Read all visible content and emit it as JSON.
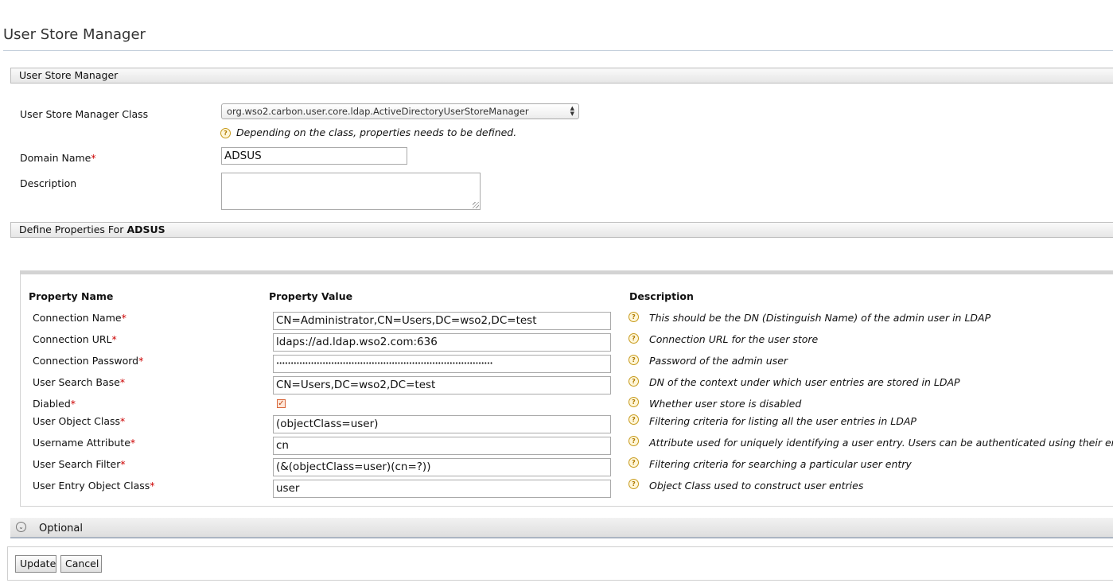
{
  "page_title": "User Store Manager",
  "section_general": {
    "title": "User Store Manager"
  },
  "form": {
    "class_label": "User Store Manager Class",
    "class_value": "org.wso2.carbon.user.core.ldap.ActiveDirectoryUserStoreManager",
    "class_hint": "Depending on the class, properties needs to be defined.",
    "domain_label": "Domain Name",
    "domain_value": "ADSUS",
    "description_label": "Description",
    "description_value": "",
    "required_marker": "*"
  },
  "section_properties": {
    "prefix": "Define Properties For ",
    "domain": "ADSUS"
  },
  "properties_table": {
    "headers": {
      "name": "Property Name",
      "value": "Property Value",
      "description": "Description"
    },
    "rows": [
      {
        "name": "Connection Name",
        "value": "CN=Administrator,CN=Users,DC=wso2,DC=test",
        "description": "This should be the DN (Distinguish Name) of the admin user in LDAP"
      },
      {
        "name": "Connection URL",
        "value": "ldaps://ad.ldap.wso2.com:636",
        "description": "Connection URL for the user store"
      },
      {
        "name": "Connection Password",
        "value": "•••••••••••••••••••••••••••••••••••••••••••••••••••••••••••••••••••••••••••",
        "description": "Password of the admin user"
      },
      {
        "name": "User Search Base",
        "value": "CN=Users,DC=wso2,DC=test",
        "description": "DN of the context under which user entries are stored in LDAP"
      },
      {
        "name": "Diabled",
        "value": "checked",
        "description": "Whether user store is disabled"
      },
      {
        "name": "User Object Class",
        "value": "(objectClass=user)",
        "description": "Filtering criteria for listing all the user entries in LDAP"
      },
      {
        "name": "Username Attribute",
        "value": "cn",
        "description": "Attribute used for uniquely identifying a user entry. Users can be authenticated using their email a"
      },
      {
        "name": "User Search Filter",
        "value": "(&(objectClass=user)(cn=?))",
        "description": "Filtering criteria for searching a particular user entry"
      },
      {
        "name": "User Entry Object Class",
        "value": "user",
        "description": "Object Class used to construct user entries"
      }
    ]
  },
  "optional_section": {
    "label": "Optional"
  },
  "buttons": {
    "update": "Update",
    "cancel": "Cancel"
  },
  "icons": {
    "help": "help-icon",
    "toggle": "chevron-down-icon",
    "checkbox_mark": "check-icon"
  },
  "colors": {
    "required": "#cc0000",
    "help_icon": "#c79a1b",
    "rule": "#c5d0dc"
  }
}
